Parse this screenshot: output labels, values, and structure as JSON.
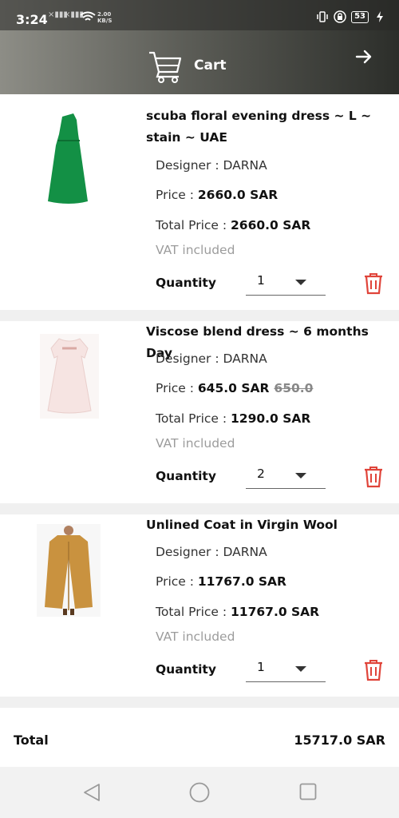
{
  "status": {
    "time": "3:24",
    "net_speed_value": "2.00",
    "net_speed_unit": "KB/S",
    "battery": "53"
  },
  "header": {
    "title": "Cart"
  },
  "items": [
    {
      "title": "scuba floral evening dress ~  L ~ stain ~  UAE",
      "designer": "Designer : DARNA",
      "price_label": "Price : ",
      "price": "2660.0 SAR",
      "old_price": "",
      "total_label": "Total Price : ",
      "total": "2660.0 SAR",
      "vat": "VAT included",
      "qty_label": "Quantity",
      "qty": "1",
      "image_color": "#139045"
    },
    {
      "title": "Viscose blend dress ~  6 months Day",
      "designer": "Designer : DARNA",
      "price_label": "Price : ",
      "price": "645.0 SAR",
      "old_price": "650.0",
      "total_label": "Total Price : ",
      "total": "1290.0 SAR",
      "vat": "VAT included",
      "qty_label": "Quantity",
      "qty": "2",
      "image_color": "#f6e4e2"
    },
    {
      "title": "Unlined Coat in Virgin Wool",
      "designer": "Designer : DARNA",
      "price_label": "Price : ",
      "price": "11767.0 SAR",
      "old_price": "",
      "total_label": "Total Price : ",
      "total": "11767.0 SAR",
      "vat": "VAT included",
      "qty_label": "Quantity",
      "qty": "1",
      "image_color": "#c9923f"
    }
  ],
  "summary": {
    "total_label": "Total",
    "total_value": "15717.0  SAR"
  },
  "colors": {
    "delete_red": "#e0443a",
    "header_dark": "#2c2e2a"
  }
}
